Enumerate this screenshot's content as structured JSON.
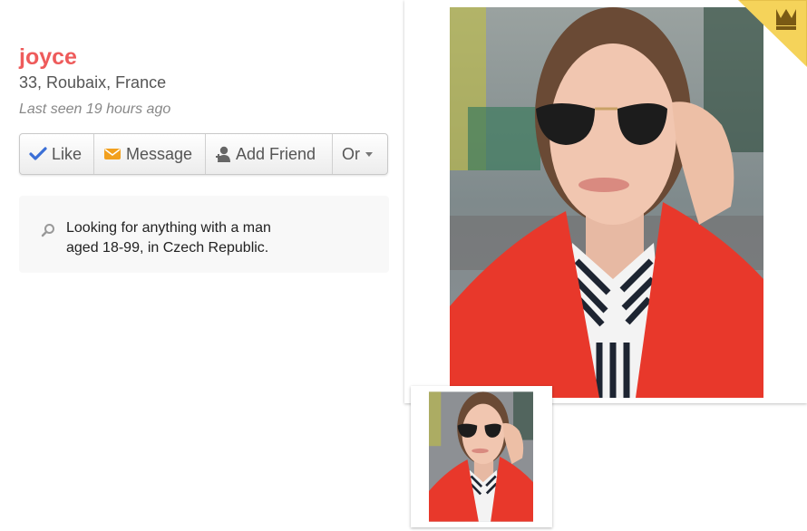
{
  "profile": {
    "name": "joyce",
    "location": "33, Roubaix, France",
    "last_seen": "Last seen 19 hours ago"
  },
  "actions": {
    "like": "Like",
    "message": "Message",
    "add_friend": "Add Friend",
    "or": "Or"
  },
  "seeking": {
    "line1": "Looking for anything with a man",
    "line2": "aged 18-99, in Czech Republic."
  },
  "icons": {
    "like": "check-icon",
    "message": "envelope-icon",
    "add_friend": "person-add-icon",
    "or": "caret-down-icon",
    "seeking": "search-icon",
    "badge": "crown-icon"
  },
  "colors": {
    "name": "#ee5b5b",
    "check": "#3b6fd6",
    "envelope": "#f2a01e",
    "badge": "#f5d35a"
  }
}
